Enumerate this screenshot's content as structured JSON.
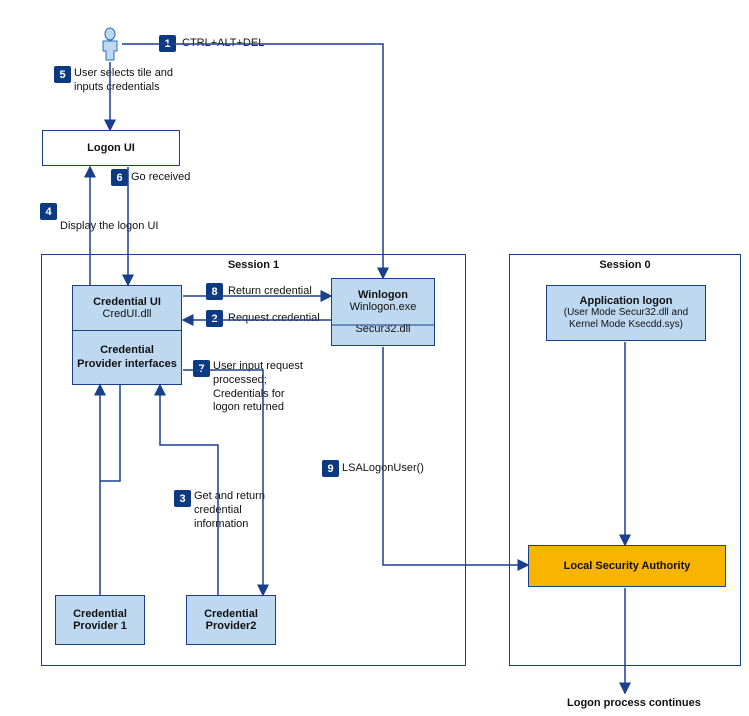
{
  "steps": {
    "s1": {
      "num": "1",
      "text": "CTRL+ALT+DEL"
    },
    "s2": {
      "num": "2",
      "text": "Request credential"
    },
    "s3": {
      "num": "3",
      "text": "Get and return credential information"
    },
    "s4": {
      "num": "4",
      "text": "Display the logon UI"
    },
    "s5": {
      "num": "5",
      "text": "User selects tile and inputs credentials"
    },
    "s6": {
      "num": "6",
      "text": "Go received"
    },
    "s7": {
      "num": "7",
      "text": "User input request processed; Credentials for logon returned"
    },
    "s8": {
      "num": "8",
      "text": "Return credential"
    },
    "s9": {
      "num": "9",
      "text": "LSALogonUser()"
    }
  },
  "boxes": {
    "logonui": {
      "title": "Logon UI"
    },
    "credui": {
      "title": "Credential UI",
      "sub": "CredUI.dll"
    },
    "credprov_if": {
      "title": "Credential Provider interfaces"
    },
    "winlogon": {
      "title": "Winlogon",
      "sub1": "Winlogon.exe",
      "sub2": "Secur32.dll"
    },
    "cp1": {
      "title": "Credential Provider 1"
    },
    "cp2": {
      "title": "Credential Provider2"
    },
    "applogon": {
      "title": "Application logon",
      "sub": "(User Mode Secur32.dll and Kernel Mode Ksecdd.sys)"
    },
    "lsa": {
      "title": "Local Security Authority"
    }
  },
  "sessions": {
    "s1": "Session 1",
    "s0": "Session 0"
  },
  "footer": "Logon process continues"
}
